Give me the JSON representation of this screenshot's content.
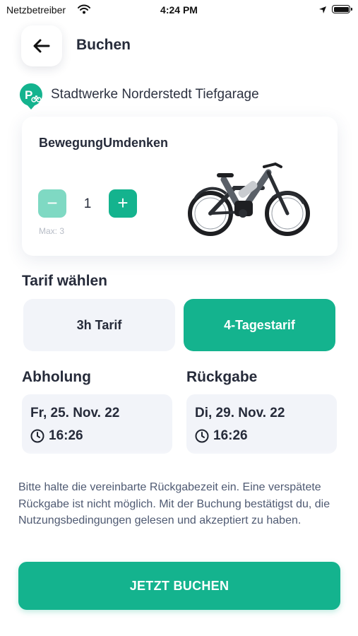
{
  "status_bar": {
    "carrier": "Netzbetreiber",
    "time": "4:24 PM"
  },
  "header": {
    "title": "Buchen",
    "back_icon": "arrow-left-icon"
  },
  "location": {
    "icon": "parking-bike-icon",
    "name": "Stadtwerke Norderstedt Tiefgarage"
  },
  "product": {
    "name": "BewegungUmdenken",
    "quantity": "1",
    "minus_label": "−",
    "plus_label": "+",
    "max_label": "Max: 3",
    "image": "e-bike-image"
  },
  "tariff": {
    "heading": "Tarif wählen",
    "options": [
      {
        "label": "3h Tarif",
        "selected": false
      },
      {
        "label": "4-Tagestarif",
        "selected": true
      }
    ]
  },
  "pickup": {
    "heading": "Abholung",
    "date": "Fr, 25. Nov. 22",
    "time": "16:26"
  },
  "return": {
    "heading": "Rückgabe",
    "date": "Di, 29. Nov. 22",
    "time": "16:26"
  },
  "notice": "Bitte halte die vereinbarte Rückgabezeit ein. Eine verspätete Rückgabe ist nicht möglich. Mit der Buchung bestätigst du, die Nutzungsbedingungen gelesen und akzeptiert zu haben.",
  "cta_label": "JETZT BUCHEN",
  "colors": {
    "accent": "#14b38e",
    "accent_disabled": "#7fd9c3",
    "surface": "#f2f4f9",
    "text": "#262b3a"
  }
}
